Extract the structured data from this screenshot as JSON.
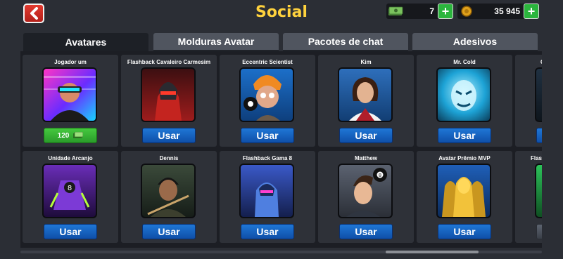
{
  "header": {
    "title": "Social"
  },
  "currency": {
    "cash": "7",
    "coins": "35 945"
  },
  "tabs": [
    "Avatares",
    "Molduras Avatar",
    "Pacotes de chat",
    "Adesivos"
  ],
  "cards": [
    {
      "name": "Jogador um",
      "button": "120"
    },
    {
      "name": "Flashback Cavaleiro Carmesim",
      "button": "Usar"
    },
    {
      "name": "Eccentric Scientist",
      "button": "Usar"
    },
    {
      "name": "Kim",
      "button": "Usar"
    },
    {
      "name": "Mr. Cold",
      "button": "Usar"
    },
    {
      "name": "C",
      "button": ""
    },
    {
      "name": "Unidade Arcanjo",
      "button": "Usar"
    },
    {
      "name": "Dennis",
      "button": "Usar"
    },
    {
      "name": "Flashback Gama 8",
      "button": "Usar"
    },
    {
      "name": "Matthew",
      "button": "Usar"
    },
    {
      "name": "Avatar Prêmio MVP",
      "button": "Usar"
    },
    {
      "name": "Flash",
      "button": ""
    }
  ],
  "colors": {
    "title": "#ffd23d",
    "use_button": "#1f77d6",
    "buy_button": "#45c93f",
    "back_button": "#e23a2f"
  },
  "icons": [
    "back-arrow-icon",
    "cash-icon",
    "coin-icon",
    "plus-icon"
  ]
}
